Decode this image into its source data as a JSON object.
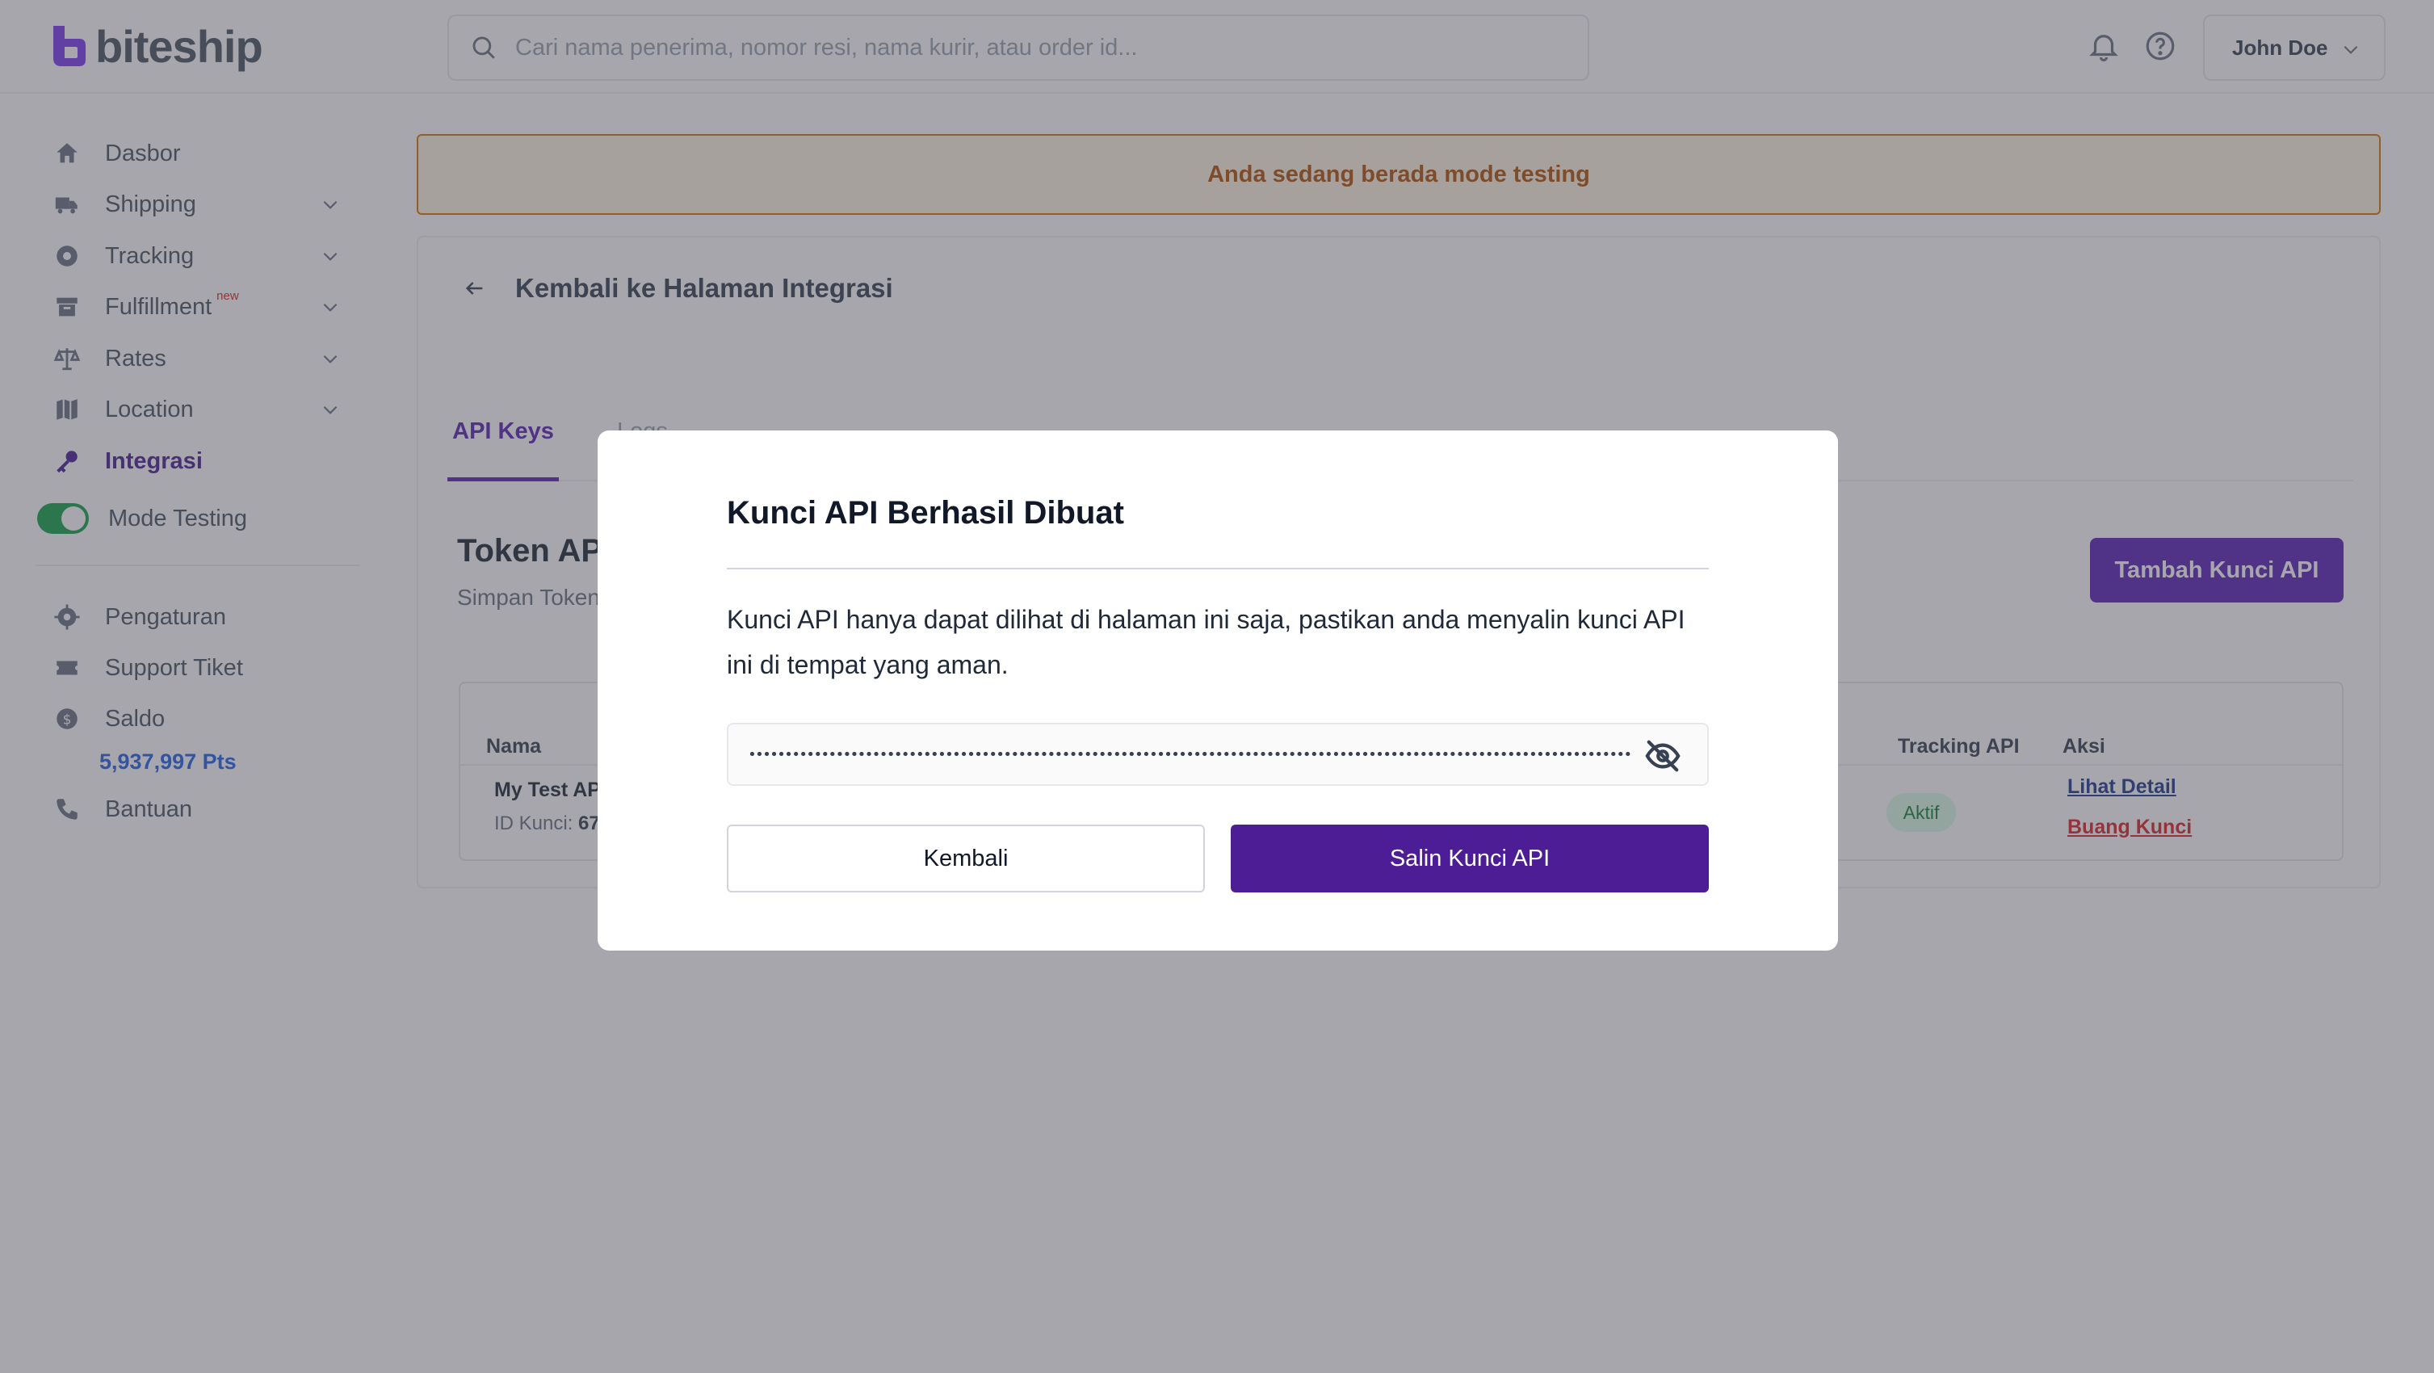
{
  "app": {
    "logo_text": "biteship"
  },
  "header": {
    "search_placeholder": "Cari nama penerima, nomor resi, nama kurir, atau order id...",
    "user_name": "John Doe",
    "icons": {
      "search": "search-icon",
      "notifications": "bell-icon",
      "help": "help-circle-icon",
      "user_menu": "chevron-down-icon"
    }
  },
  "sidebar": {
    "items": [
      {
        "label": "Dasbor",
        "icon": "home-icon"
      },
      {
        "label": "Shipping",
        "icon": "truck-icon"
      },
      {
        "label": "Tracking",
        "icon": "tracking-icon"
      },
      {
        "label": "Fulfillment",
        "badge": "new",
        "icon": "archive-icon"
      },
      {
        "label": "Rates",
        "icon": "scale-icon"
      },
      {
        "label": "Location",
        "icon": "map-icon"
      },
      {
        "label": "Integrasi",
        "icon": "key-icon"
      },
      {
        "label": "Mode Testing",
        "icon": "toggle"
      }
    ],
    "secondary": [
      {
        "label": "Pengaturan",
        "icon": "gear-icon"
      },
      {
        "label": "Support Tiket",
        "icon": "ticket-icon"
      },
      {
        "label": "Saldo",
        "icon": "coin-icon"
      },
      {
        "label": "Bantuan",
        "icon": "phone-icon"
      }
    ],
    "saldo_value": "5,937,997 Pts"
  },
  "main": {
    "banner_text": "Anda sedang berada mode testing",
    "back_label": "Kembali ke Halaman Integrasi",
    "tabs": [
      {
        "label": "API Keys"
      },
      {
        "label": "Logs"
      }
    ],
    "token_title": "Token API",
    "token_subtitle": "Simpan Token",
    "add_key_button": "Tambah Kunci API",
    "table": {
      "headers": {
        "name": "Nama",
        "tracking_api": "Tracking API",
        "actions": "Aksi"
      },
      "row": {
        "name": "My Test API",
        "id_label": "ID Kunci: ",
        "id_value": "67",
        "status": "Aktif",
        "action_detail": "Lihat Detail",
        "action_remove": "Buang Kunci"
      }
    }
  },
  "modal": {
    "title": "Kunci API Berhasil Dibuat",
    "description": "Kunci API hanya dapat dilihat di halaman ini saja, pastikan anda menyalin kunci API ini di tempat yang aman.",
    "masked_key": "••••••••••••••••••••••••••••••••••••••••••••••••••••••••••••••••••••••••••••••••••••••••••••••••••••••••••••••••••••••••••••••••",
    "visibility_icon": "eye-off-icon",
    "back_button": "Kembali",
    "copy_button": "Salin Kunci API"
  },
  "colors": {
    "brand_purple": "#4c1d95",
    "saldo_blue": "#2563eb",
    "banner_text": "#b45309",
    "danger": "#dc2626",
    "success": "#16a34a"
  }
}
